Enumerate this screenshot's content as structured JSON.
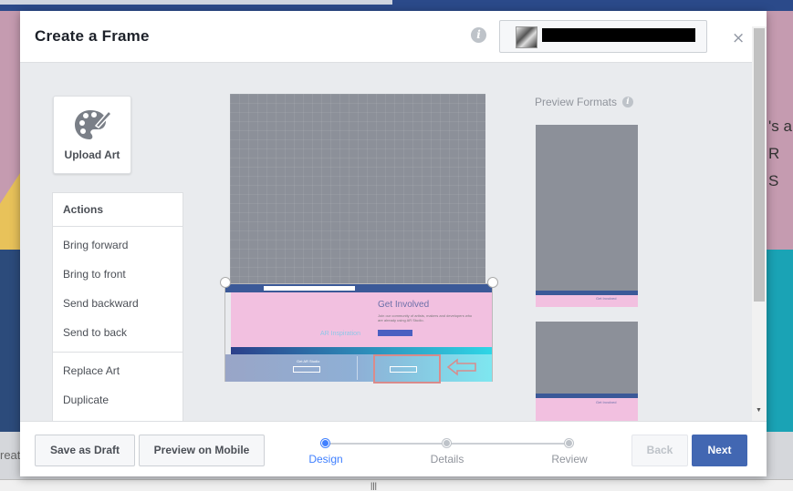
{
  "background": {
    "right_text_line1": "'s a",
    "right_text_line2": "R S",
    "left_text": "reat"
  },
  "modal": {
    "title": "Create a Frame",
    "info_glyph": "i",
    "close_glyph": "×"
  },
  "upload_art": {
    "label": "Upload Art",
    "icon": "palette-icon"
  },
  "actions": {
    "heading": "Actions",
    "group1": [
      "Bring forward",
      "Bring to front",
      "Send backward",
      "Send to back"
    ],
    "group2": [
      "Replace Art",
      "Duplicate"
    ]
  },
  "canvas": {
    "art_title": "Get Involved",
    "art_body": "Join our community of artists, makers and developers who are already using AR Studio.",
    "art_logo": "AR Inspiration",
    "art_bottom_left": "Get AR Studio"
  },
  "preview": {
    "title": "Preview Formats",
    "art_title": "Get Involved"
  },
  "footer": {
    "save_draft": "Save as Draft",
    "preview_mobile": "Preview on Mobile",
    "back": "Back",
    "next": "Next",
    "steps": [
      "Design",
      "Details",
      "Review"
    ],
    "active_step": "Design"
  },
  "colors": {
    "primary": "#4267b2",
    "active_step": "#4080ff",
    "canvas_grey": "#8c9099",
    "art_pink": "#f2c0e0",
    "fb_blue": "#3b5998"
  }
}
